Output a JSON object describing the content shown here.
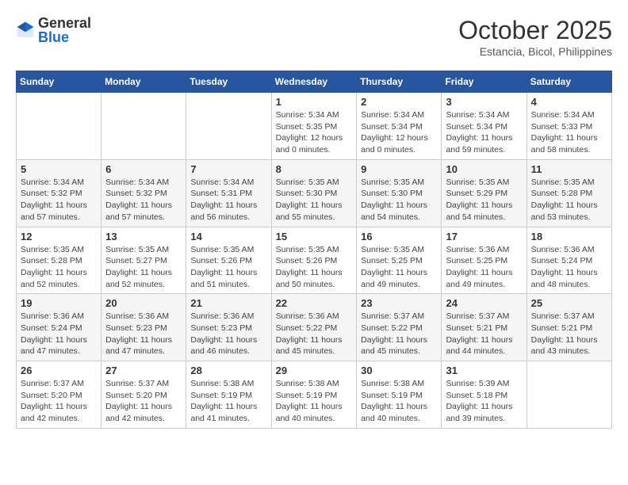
{
  "header": {
    "logo_general": "General",
    "logo_blue": "Blue",
    "month_title": "October 2025",
    "subtitle": "Estancia, Bicol, Philippines"
  },
  "calendar": {
    "days_of_week": [
      "Sunday",
      "Monday",
      "Tuesday",
      "Wednesday",
      "Thursday",
      "Friday",
      "Saturday"
    ],
    "weeks": [
      [
        {
          "day": "",
          "info": ""
        },
        {
          "day": "",
          "info": ""
        },
        {
          "day": "",
          "info": ""
        },
        {
          "day": "1",
          "info": "Sunrise: 5:34 AM\nSunset: 5:35 PM\nDaylight: 12 hours\nand 0 minutes."
        },
        {
          "day": "2",
          "info": "Sunrise: 5:34 AM\nSunset: 5:34 PM\nDaylight: 12 hours\nand 0 minutes."
        },
        {
          "day": "3",
          "info": "Sunrise: 5:34 AM\nSunset: 5:34 PM\nDaylight: 11 hours\nand 59 minutes."
        },
        {
          "day": "4",
          "info": "Sunrise: 5:34 AM\nSunset: 5:33 PM\nDaylight: 11 hours\nand 58 minutes."
        }
      ],
      [
        {
          "day": "5",
          "info": "Sunrise: 5:34 AM\nSunset: 5:32 PM\nDaylight: 11 hours\nand 57 minutes."
        },
        {
          "day": "6",
          "info": "Sunrise: 5:34 AM\nSunset: 5:32 PM\nDaylight: 11 hours\nand 57 minutes."
        },
        {
          "day": "7",
          "info": "Sunrise: 5:34 AM\nSunset: 5:31 PM\nDaylight: 11 hours\nand 56 minutes."
        },
        {
          "day": "8",
          "info": "Sunrise: 5:35 AM\nSunset: 5:30 PM\nDaylight: 11 hours\nand 55 minutes."
        },
        {
          "day": "9",
          "info": "Sunrise: 5:35 AM\nSunset: 5:30 PM\nDaylight: 11 hours\nand 54 minutes."
        },
        {
          "day": "10",
          "info": "Sunrise: 5:35 AM\nSunset: 5:29 PM\nDaylight: 11 hours\nand 54 minutes."
        },
        {
          "day": "11",
          "info": "Sunrise: 5:35 AM\nSunset: 5:28 PM\nDaylight: 11 hours\nand 53 minutes."
        }
      ],
      [
        {
          "day": "12",
          "info": "Sunrise: 5:35 AM\nSunset: 5:28 PM\nDaylight: 11 hours\nand 52 minutes."
        },
        {
          "day": "13",
          "info": "Sunrise: 5:35 AM\nSunset: 5:27 PM\nDaylight: 11 hours\nand 52 minutes."
        },
        {
          "day": "14",
          "info": "Sunrise: 5:35 AM\nSunset: 5:26 PM\nDaylight: 11 hours\nand 51 minutes."
        },
        {
          "day": "15",
          "info": "Sunrise: 5:35 AM\nSunset: 5:26 PM\nDaylight: 11 hours\nand 50 minutes."
        },
        {
          "day": "16",
          "info": "Sunrise: 5:35 AM\nSunset: 5:25 PM\nDaylight: 11 hours\nand 49 minutes."
        },
        {
          "day": "17",
          "info": "Sunrise: 5:36 AM\nSunset: 5:25 PM\nDaylight: 11 hours\nand 49 minutes."
        },
        {
          "day": "18",
          "info": "Sunrise: 5:36 AM\nSunset: 5:24 PM\nDaylight: 11 hours\nand 48 minutes."
        }
      ],
      [
        {
          "day": "19",
          "info": "Sunrise: 5:36 AM\nSunset: 5:24 PM\nDaylight: 11 hours\nand 47 minutes."
        },
        {
          "day": "20",
          "info": "Sunrise: 5:36 AM\nSunset: 5:23 PM\nDaylight: 11 hours\nand 47 minutes."
        },
        {
          "day": "21",
          "info": "Sunrise: 5:36 AM\nSunset: 5:23 PM\nDaylight: 11 hours\nand 46 minutes."
        },
        {
          "day": "22",
          "info": "Sunrise: 5:36 AM\nSunset: 5:22 PM\nDaylight: 11 hours\nand 45 minutes."
        },
        {
          "day": "23",
          "info": "Sunrise: 5:37 AM\nSunset: 5:22 PM\nDaylight: 11 hours\nand 45 minutes."
        },
        {
          "day": "24",
          "info": "Sunrise: 5:37 AM\nSunset: 5:21 PM\nDaylight: 11 hours\nand 44 minutes."
        },
        {
          "day": "25",
          "info": "Sunrise: 5:37 AM\nSunset: 5:21 PM\nDaylight: 11 hours\nand 43 minutes."
        }
      ],
      [
        {
          "day": "26",
          "info": "Sunrise: 5:37 AM\nSunset: 5:20 PM\nDaylight: 11 hours\nand 42 minutes."
        },
        {
          "day": "27",
          "info": "Sunrise: 5:37 AM\nSunset: 5:20 PM\nDaylight: 11 hours\nand 42 minutes."
        },
        {
          "day": "28",
          "info": "Sunrise: 5:38 AM\nSunset: 5:19 PM\nDaylight: 11 hours\nand 41 minutes."
        },
        {
          "day": "29",
          "info": "Sunrise: 5:38 AM\nSunset: 5:19 PM\nDaylight: 11 hours\nand 40 minutes."
        },
        {
          "day": "30",
          "info": "Sunrise: 5:38 AM\nSunset: 5:19 PM\nDaylight: 11 hours\nand 40 minutes."
        },
        {
          "day": "31",
          "info": "Sunrise: 5:39 AM\nSunset: 5:18 PM\nDaylight: 11 hours\nand 39 minutes."
        },
        {
          "day": "",
          "info": ""
        }
      ]
    ]
  }
}
